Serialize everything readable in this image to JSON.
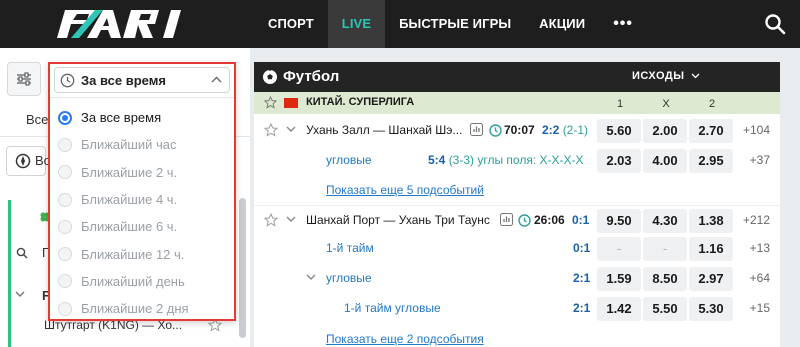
{
  "header": {
    "logo": "PARI",
    "nav": [
      {
        "label": "СПОРТ",
        "active": false
      },
      {
        "label": "LIVE",
        "active": true
      },
      {
        "label": "БЫСТРЫЕ ИГРЫ",
        "active": false
      },
      {
        "label": "АКЦИИ",
        "active": false
      }
    ],
    "more_glyph": "•••"
  },
  "sidebar": {
    "text_all": "Все",
    "text_vo": "Во",
    "text_f": "F",
    "text_p": "П",
    "match_teaser": "Штутгарт (K1NG) — Хо..."
  },
  "dropdown": {
    "selected": "За все время",
    "options": [
      {
        "label": "За все время",
        "checked": true
      },
      {
        "label": "Ближайший час",
        "checked": false
      },
      {
        "label": "Ближайшие 2 ч.",
        "checked": false
      },
      {
        "label": "Ближайшие 4 ч.",
        "checked": false
      },
      {
        "label": "Ближайшие 6 ч.",
        "checked": false
      },
      {
        "label": "Ближайшие 12 ч.",
        "checked": false
      },
      {
        "label": "Ближайший день",
        "checked": false
      },
      {
        "label": "Ближайшие 2 дня",
        "checked": false
      }
    ]
  },
  "panel": {
    "title": "Футбол",
    "outcomes_label": "ИСХОДЫ",
    "league": "КИТАЙ. СУПЕРЛИГА",
    "cols": [
      "1",
      "X",
      "2"
    ],
    "match1": {
      "name": "Ухань Залл — Шанхай Шэ...",
      "time": "70:07",
      "score": "2:2",
      "score_detail": "(2-1)",
      "odds": [
        "5.60",
        "2.00",
        "2.70"
      ],
      "more": "+104"
    },
    "match1_sub": {
      "name": "угловые",
      "score": "5:4",
      "detail": "(3-3) углы поля: X-X-X-X",
      "odds": [
        "2.03",
        "4.00",
        "2.95"
      ],
      "more": "+37"
    },
    "show_more_1": "Показать еще 5 подсобытий",
    "match2": {
      "name": "Шанхай Порт — Ухань Три Таунс",
      "time": "26:06",
      "score": "0:1",
      "odds": [
        "9.50",
        "4.30",
        "1.38"
      ],
      "more": "+212"
    },
    "match2_half": {
      "name": "1-й тайм",
      "score": "0:1",
      "odds": [
        "-",
        "-",
        "1.16"
      ],
      "more": "+13"
    },
    "match2_corners": {
      "name": "угловые",
      "score": "2:1",
      "odds": [
        "1.59",
        "8.50",
        "2.97"
      ],
      "more": "+64"
    },
    "match2_half_corners": {
      "name": "1-й тайм угловые",
      "score": "2:1",
      "odds": [
        "1.42",
        "5.50",
        "5.30"
      ],
      "more": "+15"
    },
    "show_more_2": "Показать еще 2 подсобытия"
  },
  "colors": {
    "accent": "#2ec4b6",
    "highlight_border": "#e53935",
    "link": "#2378c8",
    "league_bg": "#dde9d1"
  }
}
